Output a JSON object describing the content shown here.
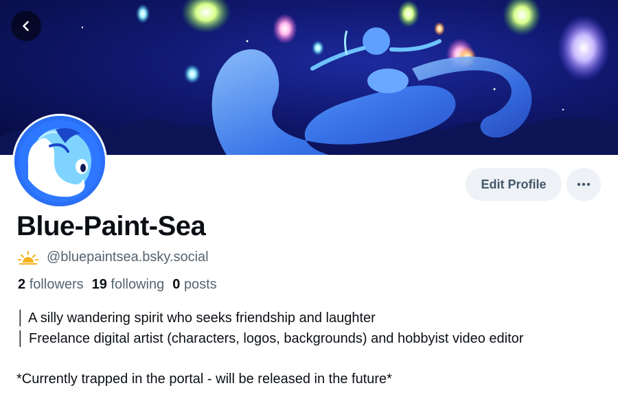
{
  "header": {
    "back_icon": "chevron-left-icon"
  },
  "profile": {
    "display_name": "Blue-Paint-Sea",
    "handle_emoji_icon": "sun-icon",
    "handle": "@bluepaintsea.bsky.social",
    "followers_count": "2",
    "followers_label": "followers",
    "following_count": "19",
    "following_label": "following",
    "posts_count": "0",
    "posts_label": "posts"
  },
  "actions": {
    "edit_profile_label": "Edit Profile",
    "more_icon": "more-horizontal-icon"
  },
  "bio": {
    "line1": "│ A silly wandering spirit who seeks friendship and laughter",
    "line2": "│ Freelance digital artist (characters, logos, backgrounds) and hobbyist video editor",
    "line3": "*Currently trapped in the portal - will be released in the future*"
  },
  "colors": {
    "button_bg": "#eef1f5",
    "muted_text": "#55636f",
    "banner_bg": "#10186e",
    "avatar_bg": "#2a6ff5"
  }
}
